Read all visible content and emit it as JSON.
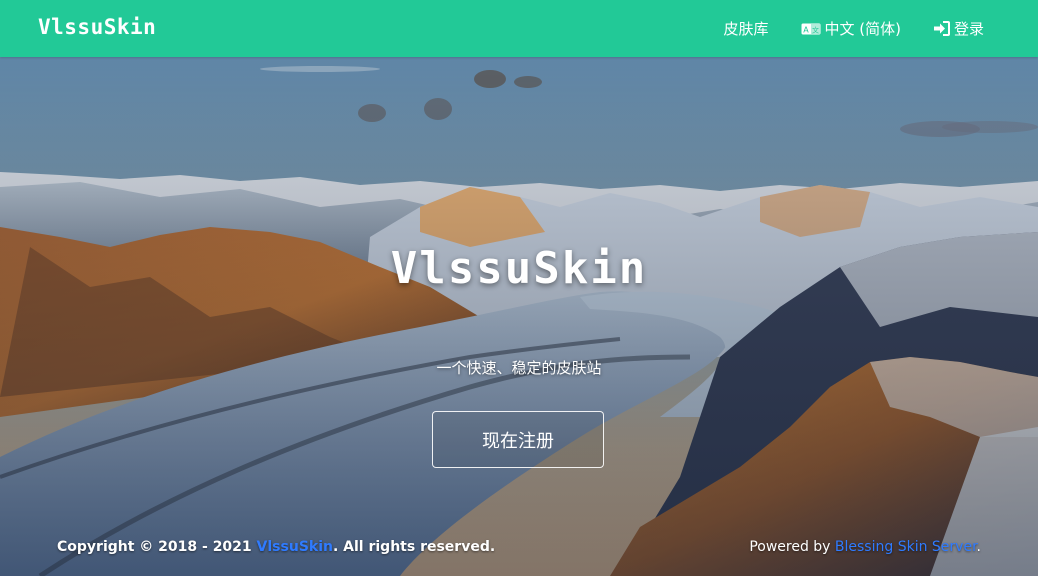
{
  "navbar": {
    "brand": "VlssuSkin",
    "links": [
      {
        "label": "皮肤库",
        "icon": "none"
      },
      {
        "label": "中文 (简体)",
        "icon": "language-icon"
      },
      {
        "label": "登录",
        "icon": "sign-in-icon"
      }
    ],
    "background_color": "#22c997"
  },
  "hero": {
    "title": "VlssuSkin",
    "subtitle": "一个快速、稳定的皮肤站",
    "register_button": "现在注册"
  },
  "footer": {
    "copyright_prefix": "Copyright © 2018 - 2021 ",
    "copyright_link": "VlssuSkin",
    "copyright_suffix": ". All rights reserved.",
    "powered_prefix": "Powered by ",
    "powered_link": "Blessing Skin Server",
    "powered_suffix": ".",
    "link_color": "#2f7bff"
  }
}
